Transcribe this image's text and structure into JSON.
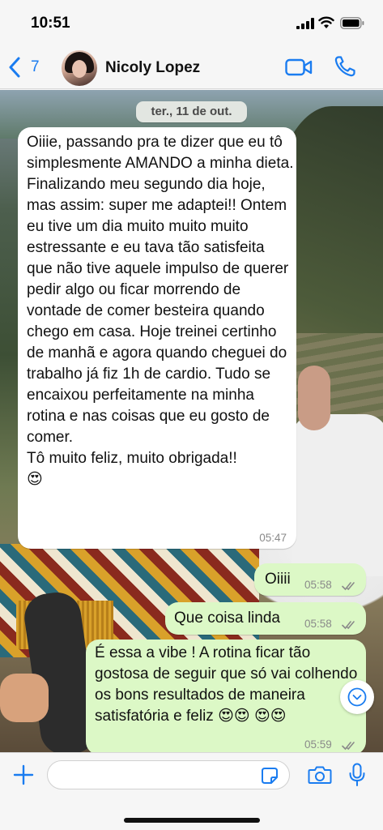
{
  "status_bar": {
    "time": "10:51"
  },
  "header": {
    "back_count": "7",
    "contact_name": "Nicoly Lopez"
  },
  "chat": {
    "date_label": "ter., 11 de out.",
    "messages": [
      {
        "direction": "incoming",
        "text": "Oiiie, passando pra te dizer que eu tô simplesmente AMANDO a minha dieta. Finalizando meu segundo dia hoje, mas assim: super me adaptei!! Ontem eu tive um dia muito muito muito estressante e eu tava tão satisfeita que não tive aquele impulso de querer pedir algo ou ficar morrendo de vontade de comer besteira quando chego em casa. Hoje treinei certinho de manhã e agora quando cheguei do trabalho já fiz 1h de cardio. Tudo se encaixou perfeitamente na minha rotina e nas coisas que eu gosto de comer.\nTô muito feliz, muito obrigada!!\n😍",
        "time": "05:47"
      },
      {
        "direction": "outgoing",
        "text": "Oiiii",
        "time": "05:58",
        "status": "read"
      },
      {
        "direction": "outgoing",
        "text": "Que coisa linda",
        "time": "05:58",
        "status": "read"
      },
      {
        "direction": "outgoing",
        "text": "É essa a vibe ! A rotina ficar tão gostosa de seguir que só vai colhendo os bons resultados de maneira satisfatória e feliz 😍😍 😍😍",
        "time": "05:59",
        "status": "read"
      }
    ]
  },
  "composer": {
    "placeholder": ""
  },
  "colors": {
    "accent": "#1a7cf0",
    "outgoing_bubble": "#dcf8c6",
    "incoming_bubble": "#ffffff"
  },
  "icons": [
    "signal-icon",
    "wifi-icon",
    "battery-icon",
    "back-chevron-icon",
    "video-call-icon",
    "phone-icon",
    "chevron-down-icon",
    "plus-icon",
    "sticker-icon",
    "camera-icon",
    "mic-icon",
    "read-ticks-icon"
  ]
}
